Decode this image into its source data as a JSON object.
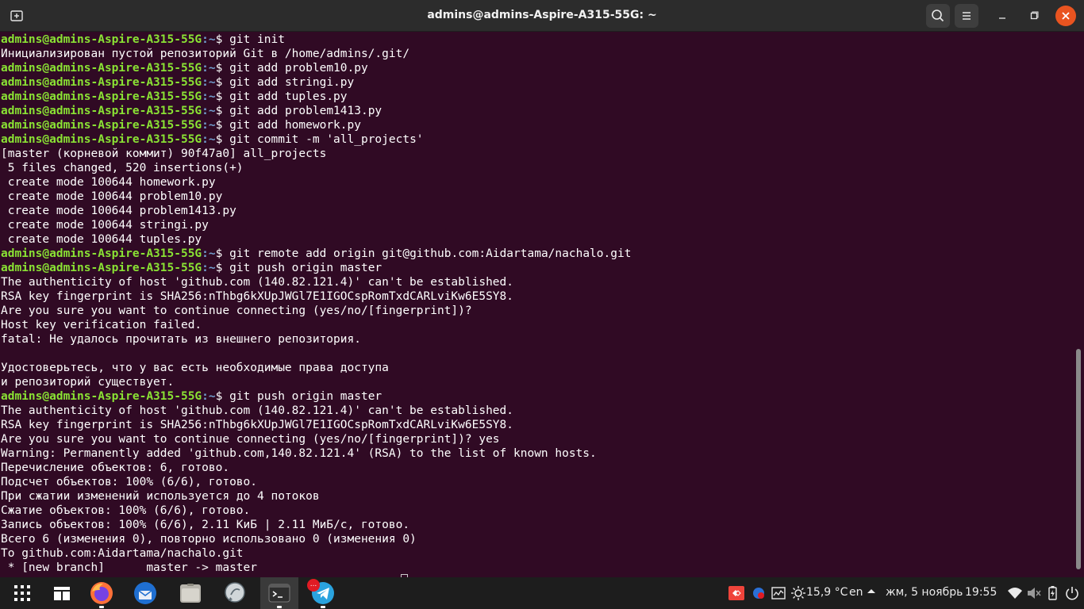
{
  "window": {
    "title": "admins@admins-Aspire-A315-55G: ~"
  },
  "prompt": {
    "user_host": "admins@admins-Aspire-A315-55G",
    "path_part": ":~",
    "dollar": "$ "
  },
  "terminal": {
    "lines": [
      {
        "cmd": "git init"
      },
      {
        "text": "Инициализирован пустой репозиторий Git в /home/admins/.git/"
      },
      {
        "cmd": "git add problem10.py"
      },
      {
        "cmd": "git add stringi.py"
      },
      {
        "cmd": "git add tuples.py"
      },
      {
        "cmd": "git add problem1413.py"
      },
      {
        "cmd": "git add homework.py"
      },
      {
        "cmd": "git commit -m 'all_projects'"
      },
      {
        "text": "[master (корневой коммит) 90f47a0] all_projects"
      },
      {
        "text": " 5 files changed, 520 insertions(+)"
      },
      {
        "text": " create mode 100644 homework.py"
      },
      {
        "text": " create mode 100644 problem10.py"
      },
      {
        "text": " create mode 100644 problem1413.py"
      },
      {
        "text": " create mode 100644 stringi.py"
      },
      {
        "text": " create mode 100644 tuples.py"
      },
      {
        "cmd": "git remote add origin git@github.com:Aidartama/nachalo.git"
      },
      {
        "cmd": "git push origin master"
      },
      {
        "text": "The authenticity of host 'github.com (140.82.121.4)' can't be established."
      },
      {
        "text": "RSA key fingerprint is SHA256:nThbg6kXUpJWGl7E1IGOCspRomTxdCARLviKw6E5SY8."
      },
      {
        "text": "Are you sure you want to continue connecting (yes/no/[fingerprint])?"
      },
      {
        "text": "Host key verification failed."
      },
      {
        "text": "fatal: Не удалось прочитать из внешнего репозитория."
      },
      {
        "text": ""
      },
      {
        "text": "Удостоверьтесь, что у вас есть необходимые права доступа"
      },
      {
        "text": "и репозиторий существует."
      },
      {
        "cmd": "git push origin master"
      },
      {
        "text": "The authenticity of host 'github.com (140.82.121.4)' can't be established."
      },
      {
        "text": "RSA key fingerprint is SHA256:nThbg6kXUpJWGl7E1IGOCspRomTxdCARLviKw6E5SY8."
      },
      {
        "text": "Are you sure you want to continue connecting (yes/no/[fingerprint])? yes"
      },
      {
        "text": "Warning: Permanently added 'github.com,140.82.121.4' (RSA) to the list of known hosts."
      },
      {
        "text": "Перечисление объектов: 6, готово."
      },
      {
        "text": "Подсчет объектов: 100% (6/6), готово."
      },
      {
        "text": "При сжатии изменений используется до 4 потоков"
      },
      {
        "text": "Сжатие объектов: 100% (6/6), готово."
      },
      {
        "text": "Запись объектов: 100% (6/6), 2.11 КиБ | 2.11 МиБ/с, готово."
      },
      {
        "text": "Всего 6 (изменения 0), повторно использовано 0 (изменения 0)"
      },
      {
        "text": "To github.com:Aidartama/nachalo.git"
      },
      {
        "text": " * [new branch]      master -> master"
      }
    ]
  },
  "dock": {
    "apps": [
      {
        "name": "apps-grid-icon"
      },
      {
        "name": "workspace-overview-icon"
      },
      {
        "name": "firefox-icon"
      },
      {
        "name": "thunderbird-icon"
      },
      {
        "name": "files-icon"
      },
      {
        "name": "chat-icon"
      },
      {
        "name": "terminal-icon"
      },
      {
        "name": "telegram-icon"
      }
    ],
    "telegram_badge": "..."
  },
  "tray": {
    "weather": "15,9 °C",
    "lang": "en",
    "date": "жм, 5 ноябрь",
    "time": "19:55"
  },
  "colors": {
    "terminal_bg": "#300a24",
    "prompt_user": "#8ae234",
    "prompt_path": "#729fcf",
    "titlebar": "#2c2c2c",
    "close_button": "#e95420"
  }
}
